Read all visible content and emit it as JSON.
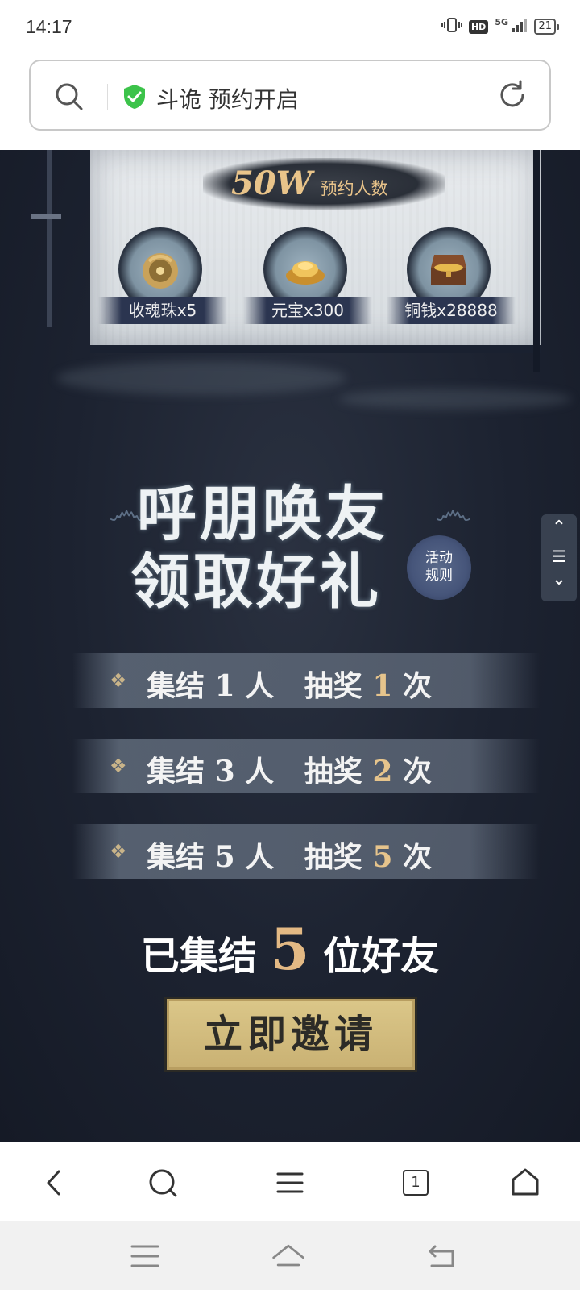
{
  "status_bar": {
    "time": "14:17",
    "network": "5G",
    "hd": "HD",
    "battery": "21"
  },
  "address_bar": {
    "title": "斗诡 预约开启",
    "icons": [
      "search-icon",
      "shield-check-icon",
      "reload-icon"
    ]
  },
  "banner": {
    "count_value": "50W",
    "count_label": "预约人数",
    "rewards": [
      {
        "label": "收魂珠x5",
        "icon": "soul-orb-icon"
      },
      {
        "label": "元宝x300",
        "icon": "gold-ingot-icon"
      },
      {
        "label": "铜钱x28888",
        "icon": "treasure-chest-icon"
      }
    ]
  },
  "event": {
    "title_line1": "呼朋唤友",
    "title_line2": "领取好礼",
    "rules_line1": "活动",
    "rules_line2": "规则",
    "rows": [
      {
        "gather_label": "集结",
        "people": "1",
        "unit": "人",
        "draw_label": "抽奖",
        "draws": "1",
        "times": "次"
      },
      {
        "gather_label": "集结",
        "people": "3",
        "unit": "人",
        "draw_label": "抽奖",
        "draws": "2",
        "times": "次"
      },
      {
        "gather_label": "集结",
        "people": "5",
        "unit": "人",
        "draw_label": "抽奖",
        "draws": "5",
        "times": "次"
      }
    ],
    "summary_prefix": "已集结",
    "summary_count": "5",
    "summary_suffix": "位好友",
    "invite_label": "立即邀请"
  },
  "side_nav": {
    "up": "⌃",
    "menu": "☰",
    "down": "⌄"
  },
  "toolbar": {
    "tab_count": "1",
    "icons": [
      "back-icon",
      "search-icon",
      "menu-icon",
      "tabs-icon",
      "home-icon"
    ]
  },
  "system_nav": {
    "icons": [
      "recents-icon",
      "home-icon",
      "back-icon"
    ]
  },
  "colors": {
    "accent_gold": "#e3b984",
    "shield_green": "#3cc34a",
    "bg_dark": "#1c2230"
  }
}
